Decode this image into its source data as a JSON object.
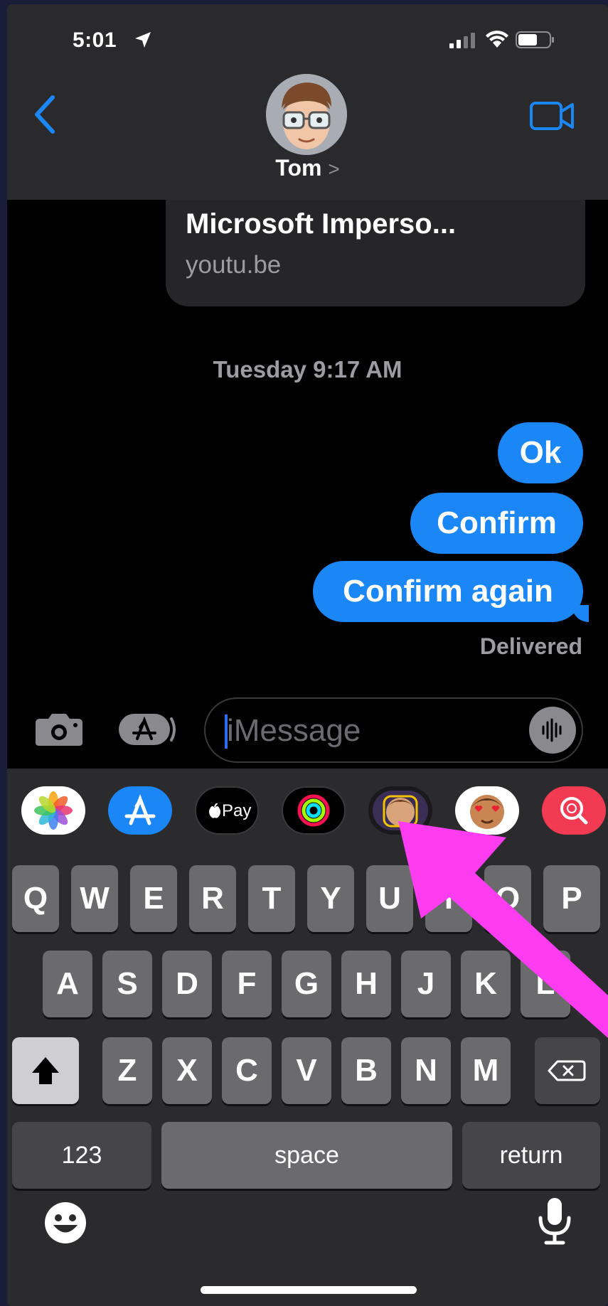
{
  "status_bar": {
    "time": "5:01"
  },
  "header": {
    "contact_name": "Tom",
    "name_chevron": ">"
  },
  "thread": {
    "link_preview": {
      "title": "Microsoft Imperso...",
      "domain": "youtu.be"
    },
    "timestamp": "Tuesday 9:17 AM",
    "messages": [
      {
        "text": "Ok"
      },
      {
        "text": "Confirm"
      },
      {
        "text": "Confirm again"
      }
    ],
    "status": "Delivered"
  },
  "composer": {
    "placeholder": "iMessage"
  },
  "app_drawer": {
    "apps": [
      "photos-app",
      "app-store-app",
      "apple-pay-app",
      "activity-app",
      "memoji-app",
      "animoji-app",
      "search-images-app"
    ],
    "apple_pay_label": "Pay"
  },
  "keyboard": {
    "row1": [
      "Q",
      "W",
      "E",
      "R",
      "T",
      "Y",
      "U",
      "I",
      "O",
      "P"
    ],
    "row2": [
      "A",
      "S",
      "D",
      "F",
      "G",
      "H",
      "J",
      "K",
      "L"
    ],
    "row3": [
      "Z",
      "X",
      "C",
      "V",
      "B",
      "N",
      "M"
    ],
    "numbers_label": "123",
    "space_label": "space",
    "return_label": "return"
  },
  "colors": {
    "accent": "#1b86f5",
    "annotation_arrow": "#ff3cf0"
  }
}
